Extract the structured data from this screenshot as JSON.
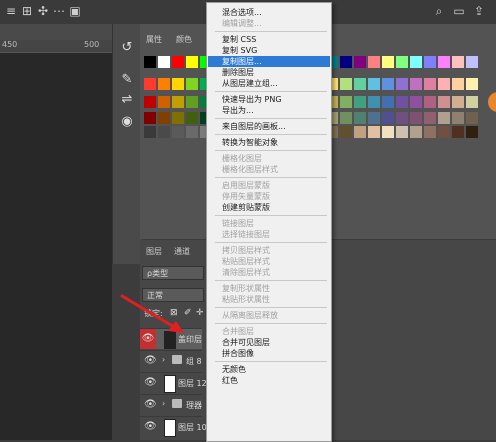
{
  "topbar": {
    "icons": [
      "align-left-icon",
      "align-center-icon",
      "distribute-icon",
      "more-icon",
      "3d-icon",
      "search-icon",
      "workspace-icon",
      "share-icon"
    ]
  },
  "ruler": {
    "marks": [
      "450",
      "500"
    ]
  },
  "swatches_panel": {
    "tabs": [
      "属性",
      "颜色"
    ]
  },
  "colors": {
    "row1": [
      "#000000",
      "#ffffff",
      "#ff0000",
      "#ffff00",
      "#00ff00",
      "#00ffff",
      "#0000ff",
      "#ff00ff",
      "#808080",
      "#c0c0c0",
      "#800000",
      "#808000",
      "#008000",
      "#008080",
      "#000080",
      "#800080",
      "#ff8080",
      "#ffff80",
      "#80ff80",
      "#80ffff",
      "#8080ff",
      "#ff80ff",
      "#ffc0c0",
      "#c0c0ff"
    ],
    "row2": [
      "#ff3b30",
      "#ff7f00",
      "#ffd400",
      "#7fd321",
      "#00b050",
      "#00b0b0",
      "#0070c0",
      "#3040c0",
      "#7030a0",
      "#c02090",
      "#e0306a",
      "#ff6a6a",
      "#ffa060",
      "#ffe070",
      "#b0e080",
      "#60d0a0",
      "#60c0e0",
      "#6090e0",
      "#9070d0",
      "#c070c0",
      "#e080a0",
      "#ffb0b0",
      "#ffd0a0",
      "#fff0b0"
    ],
    "row3": [
      "#c00000",
      "#d06000",
      "#c0a000",
      "#60a020",
      "#008040",
      "#008080",
      "#005090",
      "#203090",
      "#502080",
      "#901060",
      "#b02050",
      "#c04040",
      "#c07040",
      "#c0b050",
      "#80b060",
      "#40a080",
      "#4090b0",
      "#4070b0",
      "#7050a0",
      "#9050a0",
      "#b06080",
      "#d09090",
      "#d0b090",
      "#d0d0a0"
    ],
    "row4": [
      "#800000",
      "#804000",
      "#807000",
      "#406010",
      "#004020",
      "#004050",
      "#002050",
      "#101850",
      "#301050",
      "#500030",
      "#701030",
      "#a06060",
      "#a08060",
      "#a0a070",
      "#709060",
      "#508070",
      "#507090",
      "#505090",
      "#705080",
      "#805070",
      "#906070",
      "#b0a090",
      "#908070",
      "#706050"
    ],
    "row5": [
      "#3a3a3a",
      "#4a4a4a",
      "#5a5a5a",
      "#6a6a6a",
      "#7a7a7a",
      "#8a8a8a",
      "#9a9a9a",
      "#aaaaaa",
      "#bababa",
      "#cacaca",
      "#dadada",
      "#eaeaea",
      "#a09070",
      "#807050",
      "#605030",
      "#c0a080",
      "#e0c0a0",
      "#f0e0c0",
      "#d0c0b0",
      "#b0a090",
      "#907060",
      "#705040",
      "#503020",
      "#302010"
    ]
  },
  "layers": {
    "tabs": [
      "图层",
      "通道"
    ],
    "filter_label": "ρ类型",
    "blend_mode": "正常",
    "lock_label": "锁定:",
    "rows": [
      {
        "name": "盖印层",
        "type": "layer",
        "selected": true
      },
      {
        "name": "组 8",
        "type": "group",
        "selected": false
      },
      {
        "name": "图层 12",
        "type": "layer",
        "selected": false
      },
      {
        "name": "理器",
        "type": "group",
        "selected": false
      },
      {
        "name": "图层 10",
        "type": "layer",
        "selected": false
      }
    ]
  },
  "context_menu": {
    "items": [
      {
        "label": "混合选项...",
        "disabled": false
      },
      {
        "label": "编辑调整...",
        "disabled": true
      },
      {
        "sep": true
      },
      {
        "label": "复制 CSS",
        "disabled": false
      },
      {
        "label": "复制 SVG",
        "disabled": false
      },
      {
        "label": "复制图层...",
        "disabled": false,
        "highlighted": true
      },
      {
        "label": "删除图层",
        "disabled": false
      },
      {
        "label": "从图层建立组...",
        "disabled": false
      },
      {
        "sep": true
      },
      {
        "label": "快速导出为 PNG",
        "disabled": false
      },
      {
        "label": "导出为...",
        "disabled": false
      },
      {
        "sep": true
      },
      {
        "label": "来自图层的画板...",
        "disabled": false
      },
      {
        "sep": true
      },
      {
        "label": "转换为智能对象",
        "disabled": false
      },
      {
        "sep": true
      },
      {
        "label": "栅格化图层",
        "disabled": true
      },
      {
        "label": "栅格化图层样式",
        "disabled": true
      },
      {
        "sep": true
      },
      {
        "label": "启用图层蒙版",
        "disabled": true
      },
      {
        "label": "停用矢量蒙版",
        "disabled": true
      },
      {
        "label": "创建剪贴蒙版",
        "disabled": false
      },
      {
        "sep": true
      },
      {
        "label": "链接图层",
        "disabled": true
      },
      {
        "label": "选择链接图层",
        "disabled": true
      },
      {
        "sep": true
      },
      {
        "label": "拷贝图层样式",
        "disabled": true
      },
      {
        "label": "粘贴图层样式",
        "disabled": true
      },
      {
        "label": "清除图层样式",
        "disabled": true
      },
      {
        "sep": true
      },
      {
        "label": "复制形状属性",
        "disabled": true
      },
      {
        "label": "粘贴形状属性",
        "disabled": true
      },
      {
        "sep": true
      },
      {
        "label": "从隔离图层释放",
        "disabled": true
      },
      {
        "sep": true
      },
      {
        "label": "合并图层",
        "disabled": true
      },
      {
        "label": "合并可见图层",
        "disabled": false
      },
      {
        "label": "拼合图像",
        "disabled": false
      },
      {
        "sep": true
      },
      {
        "label": "无颜色",
        "disabled": false
      },
      {
        "label": "红色",
        "disabled": false
      }
    ]
  },
  "annotation": {
    "arrow_color": "#e02020"
  }
}
